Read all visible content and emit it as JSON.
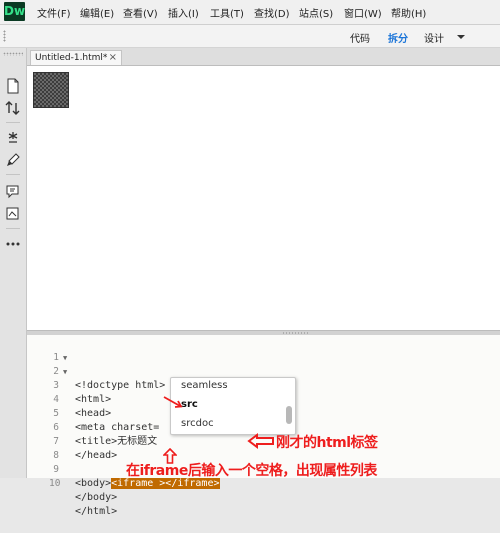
{
  "app": {
    "logo": "Dw"
  },
  "menu": [
    "文件(F)",
    "编辑(E)",
    "查看(V)",
    "插入(I)",
    "工具(T)",
    "查找(D)",
    "站点(S)",
    "窗口(W)",
    "帮助(H)"
  ],
  "view_buttons": {
    "code": "代码",
    "split": "拆分",
    "design": "设计"
  },
  "tab": {
    "title": "Untitled-1.html*",
    "close": "×"
  },
  "code_lines": [
    {
      "num": "1",
      "fold": "",
      "text": "<!doctype html>"
    },
    {
      "num": "2",
      "fold": "▼",
      "text": "<html>"
    },
    {
      "num": "3",
      "fold": "▼",
      "text": "<head>"
    },
    {
      "num": "4",
      "fold": "",
      "text": "<meta charset="
    },
    {
      "num": "5",
      "fold": "",
      "text": "<title>无标题文"
    },
    {
      "num": "6",
      "fold": "",
      "text": "</head>"
    },
    {
      "num": "7",
      "fold": "",
      "text": ""
    },
    {
      "num": "8",
      "fold": "",
      "text_before": "<body>",
      "text_highlight": "<iframe ></iframe>"
    },
    {
      "num": "9",
      "fold": "",
      "text": "</body>"
    },
    {
      "num": "10",
      "fold": "",
      "text": "</html>"
    }
  ],
  "autocomplete": [
    "seamless",
    "src",
    "srcdoc"
  ],
  "annotations": {
    "arrow_note": "刚才的html标签",
    "bottom_note": "在iframe后输入一个空格，出现属性列表"
  },
  "colors": {
    "accent": "#1a74d8",
    "highlight": "#c06a00",
    "annotation": "#ee1e1e"
  }
}
